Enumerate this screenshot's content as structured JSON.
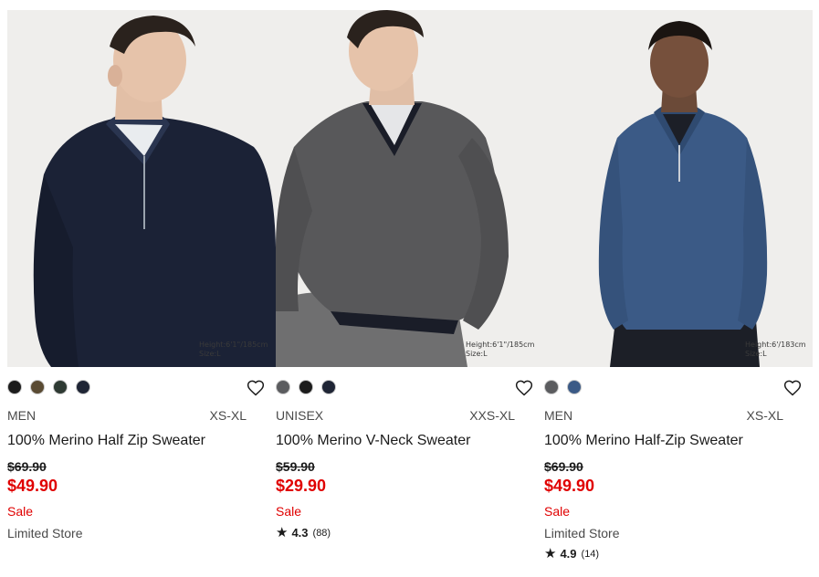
{
  "products": [
    {
      "gender": "MEN",
      "size_range": "XS-XL",
      "name": "100% Merino Half Zip Sweater",
      "original_price": "$69.90",
      "sale_price": "$49.90",
      "sale_label": "Sale",
      "store_note": "Limited Store",
      "rating_score": "",
      "rating_count": "",
      "model_info_line1": "Height:6'1\"/185cm",
      "model_info_line2": "Size:L",
      "swatch_colors": [
        "#1c1c1c",
        "#5a4b33",
        "#2e3a33",
        "#1f2535"
      ],
      "photo_subject": "model wearing navy half-zip sweater"
    },
    {
      "gender": "UNISEX",
      "size_range": "XXS-XL",
      "name": "100% Merino V-Neck Sweater",
      "original_price": "$59.90",
      "sale_price": "$29.90",
      "sale_label": "Sale",
      "store_note": "",
      "rating_score": "4.3",
      "rating_count": "(88)",
      "model_info_line1": "Height:6'1\"/185cm",
      "model_info_line2": "Size:L",
      "swatch_colors": [
        "#5b5c5f",
        "#1c1c1c",
        "#1f2535"
      ],
      "photo_subject": "model wearing gray v-neck sweater"
    },
    {
      "gender": "MEN",
      "size_range": "XS-XL",
      "name": "100% Merino Half-Zip Sweater",
      "original_price": "$69.90",
      "sale_price": "$49.90",
      "sale_label": "Sale",
      "store_note": "Limited Store",
      "rating_score": "4.9",
      "rating_count": "(14)",
      "model_info_line1": "Height:6'/183cm",
      "model_info_line2": "Size:L",
      "swatch_colors": [
        "#5b5c5f",
        "#3b5a86"
      ],
      "photo_subject": "model wearing blue half-zip sweater"
    }
  ],
  "icons": {
    "favorite": "heart-outline-icon",
    "rating": "star-icon"
  },
  "colors": {
    "sale": "#e00000",
    "text": "#1b1b1b",
    "muted": "#4a4a4a"
  }
}
